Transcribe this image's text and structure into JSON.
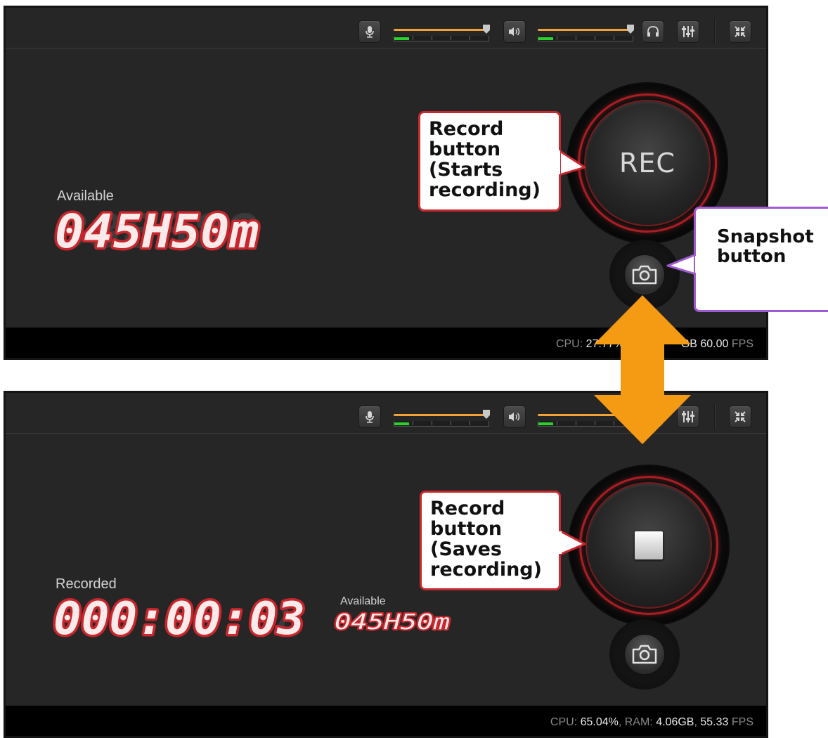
{
  "top": {
    "available_label": "Available",
    "available_value": "045H50m",
    "rec_button": "REC",
    "status": {
      "cpu_label": "CPU:",
      "cpu_value": "27.77%",
      "mid_value": "GB",
      "fps_value": "60.00",
      "fps_label": "FPS"
    }
  },
  "bottom": {
    "recorded_label": "Recorded",
    "recorded_value": "000:00:03",
    "available_label": "Available",
    "available_value": "045H50m",
    "status": {
      "cpu_label": "CPU:",
      "cpu_value": "65.04%",
      "ram_label": "RAM:",
      "ram_value": "4.06GB",
      "fps_value": "55.33",
      "fps_label": "FPS"
    }
  },
  "toolbar": {
    "mic_icon": "microphone-icon",
    "speaker_icon": "speaker-icon",
    "headphones_icon": "headphones-icon",
    "mixer_icon": "mixer-icon",
    "fullscreen_icon": "fullscreen-icon",
    "mic_volume_level": 1.0,
    "mic_meter_level": 0.16,
    "speaker_volume_level": 1.0,
    "speaker_meter_level": 0.16
  },
  "callouts": {
    "record_start": "Record\nbutton\n(Starts\nrecording)",
    "snapshot": "Snapshot\nbutton",
    "record_save": "Record\nbutton\n(Saves\nrecording)"
  },
  "colors": {
    "accent_orange": "#f0a236",
    "meter_green": "#2dd12d",
    "digit_red": "#c8262c",
    "callout_red": "#c8282e",
    "callout_purple": "#a25ad1",
    "arrow_orange": "#f59a13"
  }
}
